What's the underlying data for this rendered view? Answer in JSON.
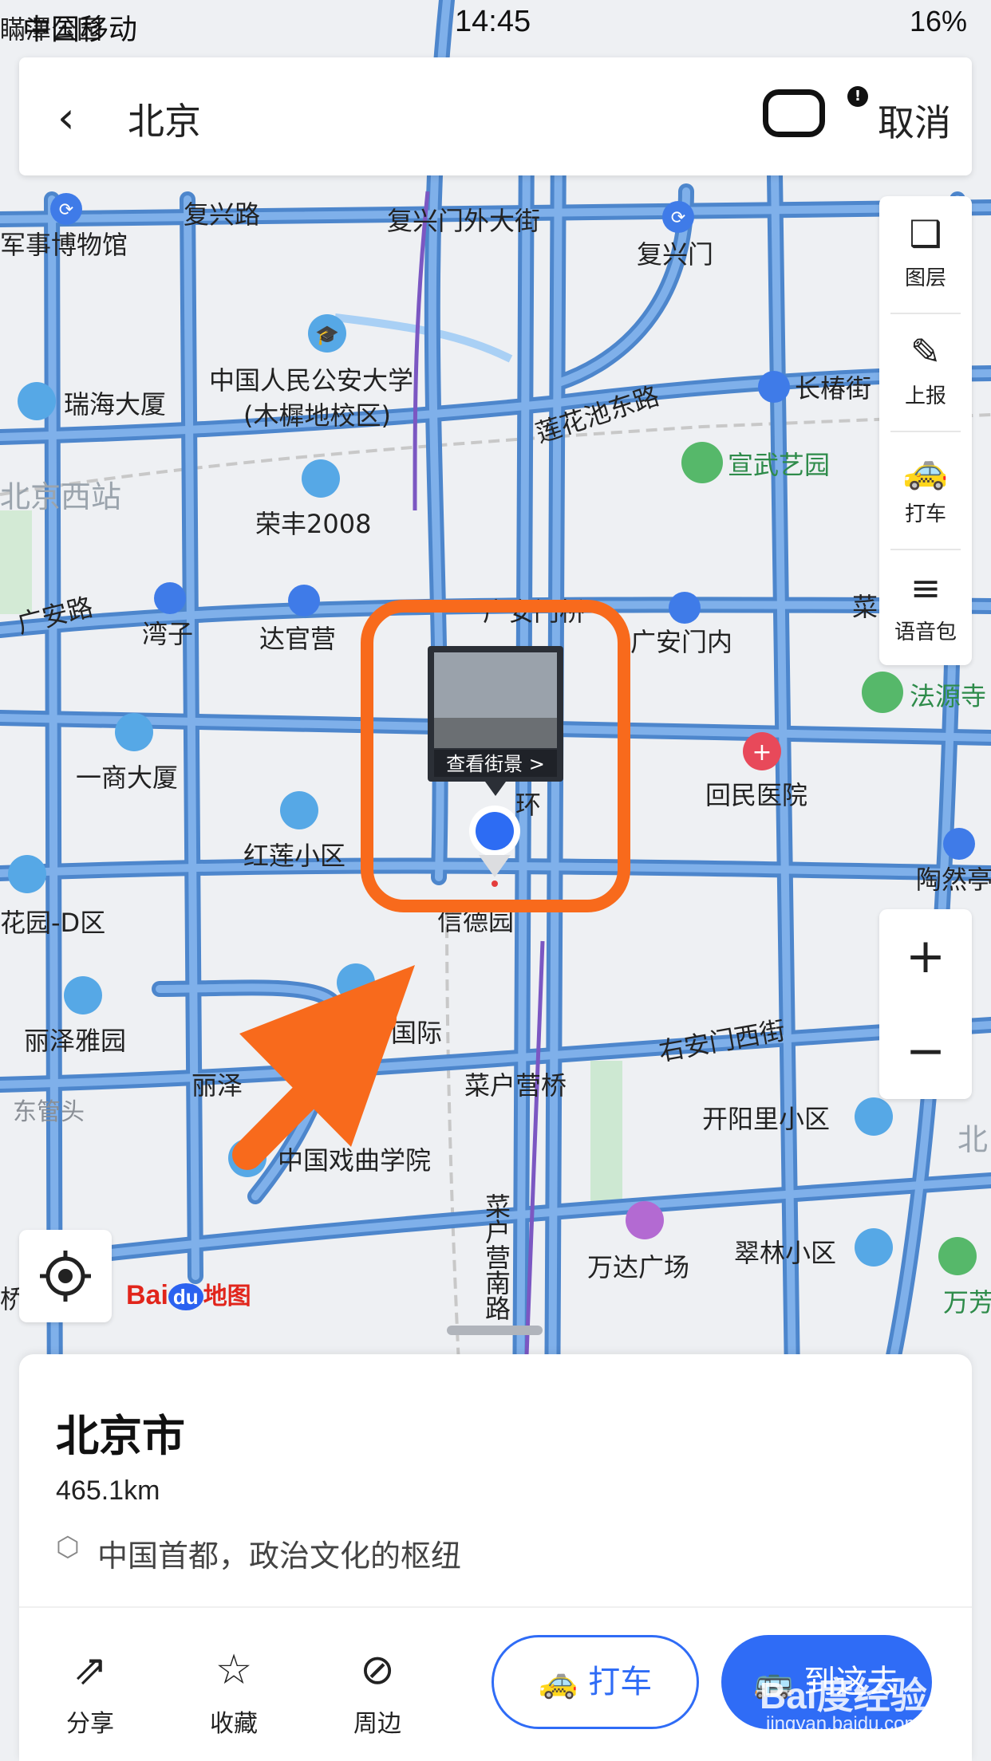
{
  "status_bar": {
    "carrier": "中国移动",
    "time": "14:45",
    "battery": "16%"
  },
  "header": {
    "back_icon": "chevron-left-icon",
    "title": "北京",
    "cancel_label": "取消"
  },
  "side_tools": [
    {
      "label": "图层",
      "icon": "layers-icon"
    },
    {
      "label": "上报",
      "icon": "report-edit-icon"
    },
    {
      "label": "打车",
      "icon": "taxi-icon"
    },
    {
      "label": "语音包",
      "icon": "voice-icon"
    }
  ],
  "zoom": {
    "in": "+",
    "out": "−"
  },
  "map": {
    "streetview_label": "查看街景 >",
    "brand": {
      "bai": "Bai",
      "du": "du",
      "ditu": "地图"
    },
    "labels": [
      "瞞澤公园",
      "复兴路",
      "复兴门外大街",
      "复兴门",
      "军事博物馆",
      "中国人民公安大学",
      "(木樨地校区)",
      "瑞海大厦",
      "莲花池东路",
      "长椿街",
      "宣武艺园",
      "北京西站",
      "荣丰2008",
      "广安路",
      "湾子",
      "达官营",
      "广安门桥",
      "广安门内",
      "菜",
      "法源寺",
      "一商大厦",
      "回民医院",
      "红莲小区",
      "环",
      "陶然亭",
      "花园-D区",
      "信德园",
      "丽泽雅园",
      "国际",
      "右安门西街",
      "丽泽",
      "菜户营桥",
      "东管头",
      "开阳里小区",
      "北",
      "中国戏曲学院",
      "菜户营南路",
      "万达广场",
      "翠林小区",
      "万芳",
      "桥"
    ]
  },
  "place": {
    "name": "北京市",
    "distance": "465.1km",
    "description": "中国首都，政治文化的枢纽"
  },
  "actions": [
    {
      "label": "分享",
      "icon": "share-icon"
    },
    {
      "label": "收藏",
      "icon": "star-icon"
    },
    {
      "label": "周边",
      "icon": "compass-icon"
    }
  ],
  "buttons": {
    "taxi": "打车",
    "go": "到这去"
  },
  "watermark": {
    "main": "Bai度经验",
    "sub": "jingyan.baidu.com"
  },
  "colors": {
    "road": "#6aa0e0",
    "road_edge": "#4d86cc",
    "accent": "#2f6cf6",
    "annotation": "#f86a1c"
  }
}
